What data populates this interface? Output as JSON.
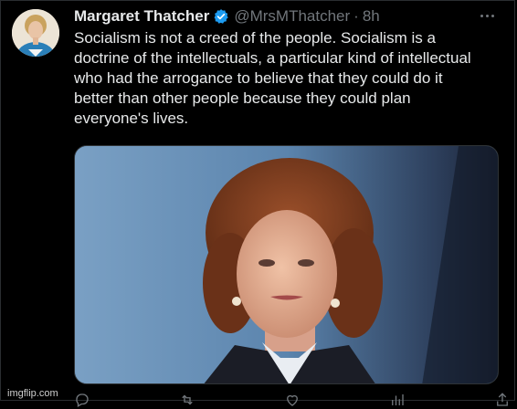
{
  "tweet": {
    "author_name": "Margaret Thatcher",
    "handle": "@MrsMThatcher",
    "separator": "·",
    "time": "8h",
    "text_lines": [
      "Socialism is not a creed of the people. Socialism is a",
      "doctrine of the intellectuals, a particular kind of intellectual",
      "who had the arrogance to believe that they could do it",
      "better than other people because they could plan",
      "everyone's lives."
    ]
  },
  "icons": {
    "verified": "verified-badge-icon",
    "more": "more-options-icon",
    "reply": "reply-icon",
    "retweet": "retweet-icon",
    "like": "like-icon",
    "views": "views-icon",
    "share": "share-icon"
  },
  "colors": {
    "background": "#000000",
    "text": "#e7e9ea",
    "muted": "#71767b",
    "verified": "#1d9bf0"
  },
  "watermark": "imgflip.com"
}
